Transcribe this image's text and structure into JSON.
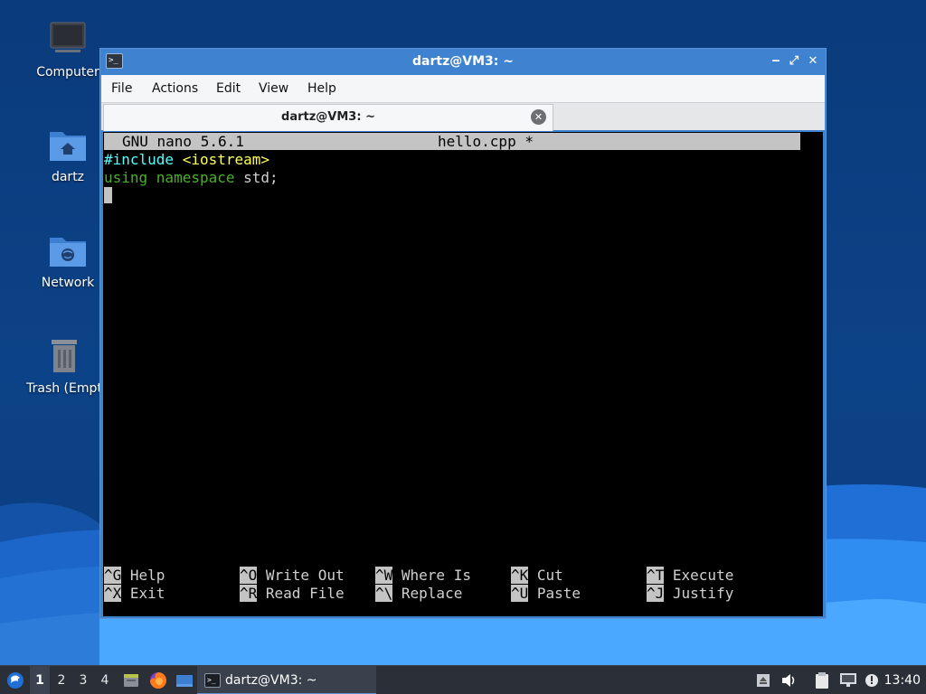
{
  "desktop": {
    "icons": [
      {
        "label": "Computer"
      },
      {
        "label": "dartz"
      },
      {
        "label": "Network"
      },
      {
        "label": "Trash (Empt"
      }
    ]
  },
  "window": {
    "title": "dartz@VM3: ~",
    "app_icon_glyph": ">_",
    "controls": {
      "minimize": "‒",
      "maximize": "⤢",
      "close": "✕"
    },
    "menu": [
      "File",
      "Actions",
      "Edit",
      "View",
      "Help"
    ],
    "tab": {
      "label": "dartz@VM3: ~",
      "close_glyph": "✕"
    }
  },
  "nano": {
    "version": "GNU nano 5.6.1",
    "filename": "hello.cpp *",
    "lines": [
      {
        "parts": [
          {
            "text": "#include ",
            "color": "#55ffff"
          },
          {
            "text": "<iostream>",
            "color": "#ffff55"
          }
        ]
      },
      {
        "parts": [
          {
            "text": "using ",
            "color": "#4cae2a"
          },
          {
            "text": "namespace ",
            "color": "#4cae2a"
          },
          {
            "text": "std;",
            "color": "#d0d0d0"
          }
        ]
      }
    ],
    "shortcuts": {
      "row1": [
        {
          "key": "^G",
          "label": "Help"
        },
        {
          "key": "^O",
          "label": "Write Out"
        },
        {
          "key": "^W",
          "label": "Where Is"
        },
        {
          "key": "^K",
          "label": "Cut"
        },
        {
          "key": "^T",
          "label": "Execute"
        }
      ],
      "row2": [
        {
          "key": "^X",
          "label": "Exit"
        },
        {
          "key": "^R",
          "label": "Read File"
        },
        {
          "key": "^\\",
          "label": "Replace"
        },
        {
          "key": "^U",
          "label": "Paste"
        },
        {
          "key": "^J",
          "label": "Justify"
        }
      ]
    }
  },
  "taskbar": {
    "workspaces": [
      "1",
      "2",
      "3",
      "4"
    ],
    "active_workspace": "1",
    "task_label": "dartz@VM3: ~",
    "clock": "13:40"
  },
  "colors": {
    "titlebar": "#3f82cf",
    "terminal_bg": "#000000",
    "taskbar": "#2a2f38",
    "nano_header": "#c4c4c4"
  }
}
